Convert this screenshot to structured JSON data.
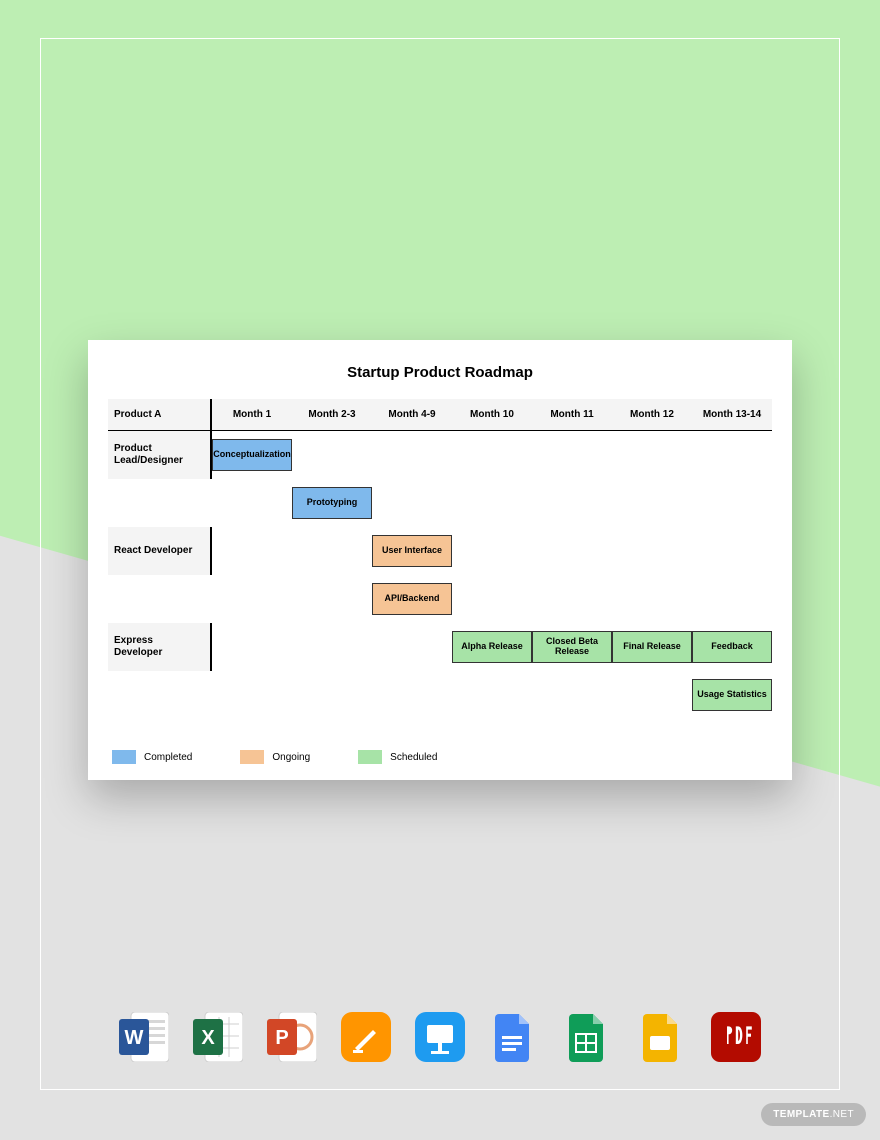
{
  "title": "Startup Product Roadmap",
  "row_header": "Product A",
  "columns": [
    "Month 1",
    "Month 2-3",
    "Month 4-9",
    "Month 10",
    "Month 11",
    "Month 12",
    "Month 13-14"
  ],
  "roles": [
    "Product Lead/Designer",
    "React Developer",
    "Express Developer"
  ],
  "bars": {
    "concept": {
      "label": "Conceptualization",
      "color": "blue",
      "col": 0
    },
    "proto": {
      "label": "Prototyping",
      "color": "blue",
      "col": 1
    },
    "ui": {
      "label": "User Interface",
      "color": "orange",
      "col": 2
    },
    "api": {
      "label": "API/Backend",
      "color": "orange",
      "col": 2
    },
    "alpha": {
      "label": "Alpha Release",
      "color": "green",
      "col": 3
    },
    "beta": {
      "label": "Closed Beta Release",
      "color": "green",
      "col": 4
    },
    "final": {
      "label": "Final Release",
      "color": "green",
      "col": 5
    },
    "feedback": {
      "label": "Feedback",
      "color": "green",
      "col": 6
    },
    "usage": {
      "label": "Usage Statistics",
      "color": "green",
      "col": 6
    }
  },
  "legend": [
    {
      "label": "Completed",
      "color": "blue"
    },
    {
      "label": "Ongoing",
      "color": "orange"
    },
    {
      "label": "Scheduled",
      "color": "green"
    }
  ],
  "apps": [
    "Word",
    "Excel",
    "PowerPoint",
    "Pages",
    "Keynote",
    "Google Docs",
    "Google Sheets",
    "Google Slides",
    "Adobe PDF"
  ],
  "watermark": {
    "brand": "TEMPLATE",
    "suffix": ".NET"
  },
  "colors": {
    "blue": "#7fb9ec",
    "orange": "#f6c495",
    "green": "#a7e3a7"
  },
  "chart_data": {
    "type": "table",
    "title": "Startup Product Roadmap",
    "columns": [
      "Month 1",
      "Month 2-3",
      "Month 4-9",
      "Month 10",
      "Month 11",
      "Month 12",
      "Month 13-14"
    ],
    "rows": [
      {
        "role": "Product Lead/Designer",
        "tasks": [
          {
            "label": "Conceptualization",
            "start": "Month 1",
            "end": "Month 1",
            "status": "Completed"
          },
          {
            "label": "Prototyping",
            "start": "Month 2-3",
            "end": "Month 2-3",
            "status": "Completed"
          }
        ]
      },
      {
        "role": "React Developer",
        "tasks": [
          {
            "label": "User Interface",
            "start": "Month 4-9",
            "end": "Month 4-9",
            "status": "Ongoing"
          },
          {
            "label": "API/Backend",
            "start": "Month 4-9",
            "end": "Month 4-9",
            "status": "Ongoing"
          }
        ]
      },
      {
        "role": "Express Developer",
        "tasks": [
          {
            "label": "Alpha Release",
            "start": "Month 10",
            "end": "Month 10",
            "status": "Scheduled"
          },
          {
            "label": "Closed Beta Release",
            "start": "Month 11",
            "end": "Month 11",
            "status": "Scheduled"
          },
          {
            "label": "Final Release",
            "start": "Month 12",
            "end": "Month 12",
            "status": "Scheduled"
          },
          {
            "label": "Feedback",
            "start": "Month 13-14",
            "end": "Month 13-14",
            "status": "Scheduled"
          },
          {
            "label": "Usage Statistics",
            "start": "Month 13-14",
            "end": "Month 13-14",
            "status": "Scheduled"
          }
        ]
      }
    ],
    "legend": [
      {
        "label": "Completed",
        "color": "#7fb9ec"
      },
      {
        "label": "Ongoing",
        "color": "#f6c495"
      },
      {
        "label": "Scheduled",
        "color": "#a7e3a7"
      }
    ]
  }
}
